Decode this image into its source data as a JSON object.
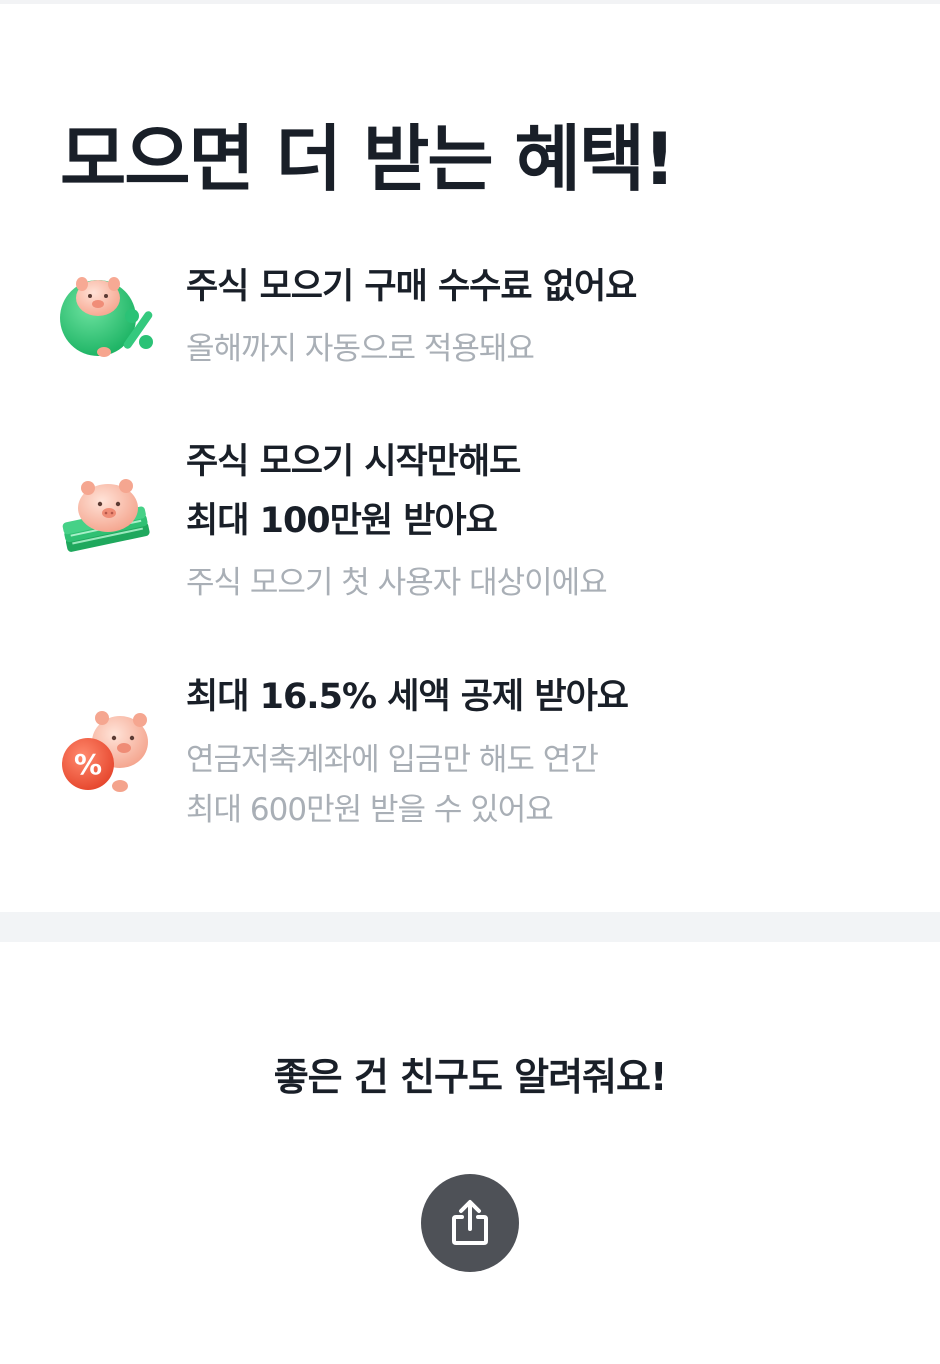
{
  "header": {
    "title": "모으면 더 받는 혜택!"
  },
  "benefits": [
    {
      "icon": "piggy-percent-green-icon",
      "title_lines": [
        "주식 모으기 구매 수수료 없어요"
      ],
      "desc_lines": [
        "올해까지 자동으로 적용돼요"
      ]
    },
    {
      "icon": "piggy-cash-stack-icon",
      "title_lines": [
        "주식 모으기 시작만해도",
        "최대 100만원 받아요"
      ],
      "desc_lines": [
        "주식 모으기 첫 사용자 대상이에요"
      ]
    },
    {
      "icon": "piggy-percent-red-icon",
      "title_lines": [
        "최대 16.5% 세액 공제 받아요"
      ],
      "desc_lines": [
        "연금저축계좌에 입금만 해도 연간",
        "최대 600만원 받을 수 있어요"
      ]
    }
  ],
  "share": {
    "heading": "좋은 건 친구도 알려줘요!",
    "button_icon": "share-icon"
  },
  "colors": {
    "title": "#191f28",
    "description": "#a9afb6",
    "share_button": "#4e5157",
    "divider": "#f2f4f6"
  }
}
